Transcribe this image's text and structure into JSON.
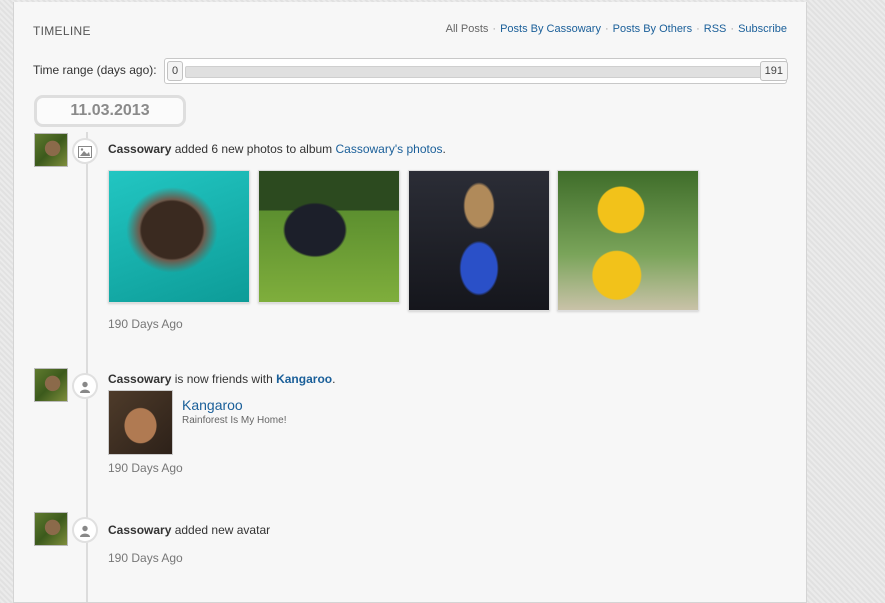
{
  "header": {
    "title": "TIMELINE",
    "nav": {
      "all_posts": "All Posts",
      "posts_by_cassowary": "Posts By Cassowary",
      "posts_by_others": "Posts By Others",
      "rss": "RSS",
      "subscribe": "Subscribe",
      "separator": "·"
    }
  },
  "range": {
    "label": "Time range (days ago):",
    "min": "0",
    "max": "191"
  },
  "date_badge": "11.03.2013",
  "events": [
    {
      "user": "Cassowary",
      "action": " added 6 new photos to album ",
      "album": "Cassowary's photos",
      "suffix": ".",
      "time_ago": "190 Days Ago",
      "icon": "image-icon"
    },
    {
      "user": "Cassowary",
      "action": " is now friends with ",
      "friend": "Kangaroo",
      "suffix": ".",
      "friend_card": {
        "name": "Kangaroo",
        "tagline": "Rainforest Is My Home!"
      },
      "time_ago": "190 Days Ago",
      "icon": "user-icon"
    },
    {
      "user": "Cassowary",
      "action": " added new avatar",
      "time_ago": "190 Days Ago",
      "icon": "user-icon"
    }
  ],
  "colors": {
    "link": "#1a5f99",
    "panel": "#f7f7f7",
    "background": "#e6e6e6"
  }
}
